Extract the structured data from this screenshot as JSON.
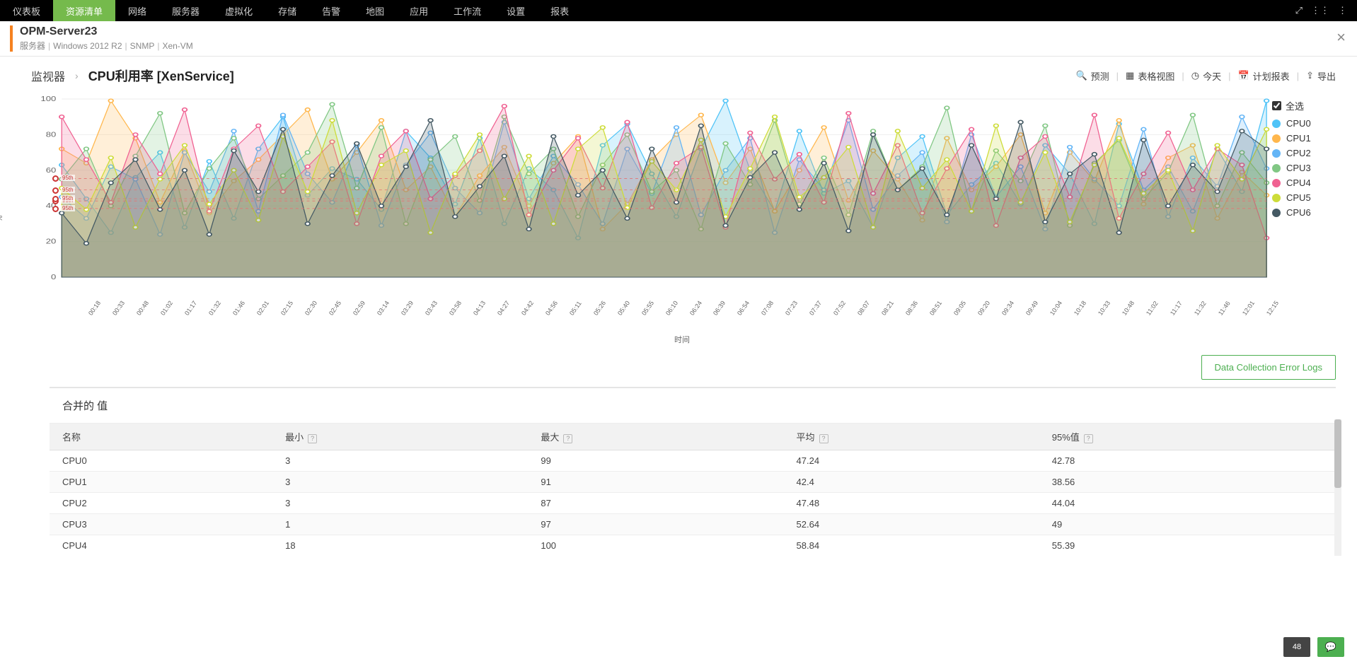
{
  "nav": {
    "items": [
      "仪表板",
      "资源清单",
      "网络",
      "服务器",
      "虚拟化",
      "存储",
      "告警",
      "地图",
      "应用",
      "工作流",
      "设置",
      "报表"
    ],
    "active": 1
  },
  "header": {
    "title": "OPM-Server23",
    "sub": [
      "服务器",
      "Windows 2012 R2",
      "SNMP",
      "Xen-VM"
    ]
  },
  "toolbar": {
    "crumb_monitor": "监视器",
    "crumb_current": "CPU利用率 [XenService]",
    "predict": "预测",
    "tableview": "表格视图",
    "today": "今天",
    "schedule": "计划报表",
    "export": "导出"
  },
  "btn": {
    "error_logs": "Data Collection Error Logs"
  },
  "legend": {
    "select_all": "全选"
  },
  "xlabel": "时间",
  "ylabel": "%",
  "table": {
    "title": "合并的 值",
    "cols": [
      "名称",
      "最小",
      "最大",
      "平均",
      "95%值"
    ],
    "rows": [
      [
        "CPU0",
        "3",
        "99",
        "47.24",
        "42.78"
      ],
      [
        "CPU1",
        "3",
        "91",
        "42.4",
        "38.56"
      ],
      [
        "CPU2",
        "3",
        "87",
        "47.48",
        "44.04"
      ],
      [
        "CPU3",
        "1",
        "97",
        "52.64",
        "49"
      ],
      [
        "CPU4",
        "18",
        "100",
        "58.84",
        "55.39"
      ]
    ]
  },
  "badge_count": "48",
  "chart_data": {
    "type": "area",
    "categories": [
      "00:18",
      "00:33",
      "00:48",
      "01:02",
      "01:17",
      "01:32",
      "01:46",
      "02:01",
      "02:15",
      "02:30",
      "02:45",
      "02:59",
      "03:14",
      "03:29",
      "03:43",
      "03:58",
      "04:13",
      "04:27",
      "04:42",
      "04:56",
      "05:11",
      "05:26",
      "05:40",
      "05:55",
      "06:10",
      "06:24",
      "06:39",
      "06:54",
      "07:08",
      "07:23",
      "07:37",
      "07:52",
      "08:07",
      "08:21",
      "08:36",
      "08:51",
      "09:05",
      "09:20",
      "09:34",
      "09:49",
      "10:04",
      "10:18",
      "10:33",
      "10:48",
      "11:02",
      "11:17",
      "11:32",
      "11:46",
      "12:01",
      "12:15"
    ],
    "series": [
      {
        "name": "CPU0",
        "color": "#4fc3f7",
        "values": [
          63,
          44,
          25,
          56,
          70,
          28,
          65,
          33,
          72,
          90,
          46,
          61,
          55,
          38,
          82,
          67,
          41,
          78,
          30,
          61,
          49,
          22,
          74,
          86,
          58,
          34,
          72,
          99,
          60,
          37,
          82,
          47,
          54,
          28,
          67,
          79,
          35,
          52,
          64,
          41,
          74,
          58,
          30,
          86,
          49,
          62,
          37,
          72,
          48,
          99
        ]
      },
      {
        "name": "CPU1",
        "color": "#ffb74d",
        "values": [
          72,
          64,
          99,
          78,
          42,
          71,
          36,
          54,
          66,
          80,
          94,
          55,
          70,
          88,
          49,
          62,
          34,
          57,
          73,
          40,
          64,
          79,
          27,
          41,
          66,
          80,
          91,
          53,
          72,
          37,
          60,
          84,
          43,
          71,
          55,
          32,
          78,
          49,
          62,
          80,
          36,
          70,
          54,
          88,
          41,
          67,
          74,
          33,
          59,
          46
        ]
      },
      {
        "name": "CPU2",
        "color": "#64b5f6",
        "values": [
          45,
          33,
          62,
          55,
          24,
          70,
          48,
          82,
          37,
          91,
          58,
          42,
          74,
          29,
          63,
          81,
          50,
          36,
          87,
          44,
          68,
          52,
          30,
          72,
          47,
          84,
          35,
          60,
          78,
          25,
          66,
          49,
          88,
          38,
          57,
          70,
          31,
          80,
          45,
          62,
          27,
          73,
          55,
          40,
          83,
          34,
          67,
          51,
          90,
          61
        ]
      },
      {
        "name": "CPU3",
        "color": "#81c784",
        "values": [
          55,
          72,
          40,
          68,
          92,
          36,
          61,
          78,
          44,
          57,
          70,
          97,
          50,
          84,
          30,
          66,
          79,
          43,
          90,
          58,
          72,
          34,
          63,
          80,
          48,
          60,
          27,
          75,
          52,
          88,
          41,
          67,
          35,
          82,
          49,
          62,
          95,
          37,
          71,
          54,
          85,
          29,
          64,
          77,
          44,
          59,
          91,
          40,
          70,
          53
        ]
      },
      {
        "name": "CPU4",
        "color": "#f06292",
        "values": [
          90,
          66,
          42,
          80,
          58,
          94,
          37,
          72,
          85,
          48,
          62,
          76,
          30,
          68,
          82,
          44,
          57,
          71,
          96,
          35,
          60,
          78,
          50,
          87,
          39,
          64,
          73,
          28,
          81,
          55,
          69,
          42,
          92,
          47,
          74,
          36,
          61,
          83,
          29,
          67,
          79,
          45,
          91,
          33,
          58,
          81,
          49,
          72,
          63,
          22
        ]
      },
      {
        "name": "CPU5",
        "color": "#cddc39",
        "values": [
          50,
          38,
          67,
          28,
          55,
          74,
          41,
          60,
          32,
          79,
          48,
          88,
          36,
          63,
          71,
          25,
          58,
          80,
          44,
          68,
          30,
          72,
          84,
          39,
          65,
          49,
          77,
          34,
          61,
          90,
          45,
          56,
          73,
          28,
          82,
          50,
          66,
          37,
          85,
          42,
          70,
          31,
          63,
          78,
          47,
          60,
          26,
          74,
          55,
          83
        ]
      },
      {
        "name": "CPU6",
        "color": "#455a64",
        "values": [
          36,
          19,
          53,
          66,
          38,
          60,
          24,
          71,
          48,
          83,
          30,
          57,
          75,
          40,
          62,
          88,
          34,
          51,
          68,
          27,
          79,
          46,
          60,
          33,
          72,
          42,
          85,
          29,
          56,
          70,
          38,
          64,
          26,
          80,
          49,
          61,
          35,
          74,
          44,
          87,
          31,
          58,
          69,
          25,
          77,
          40,
          63,
          48,
          82,
          72
        ]
      }
    ],
    "ylim": [
      0,
      100
    ],
    "yticks": [
      0,
      20,
      40,
      60,
      80,
      100
    ],
    "p95_markers": [
      42.78,
      38.56,
      44.04,
      49,
      55.39
    ]
  }
}
